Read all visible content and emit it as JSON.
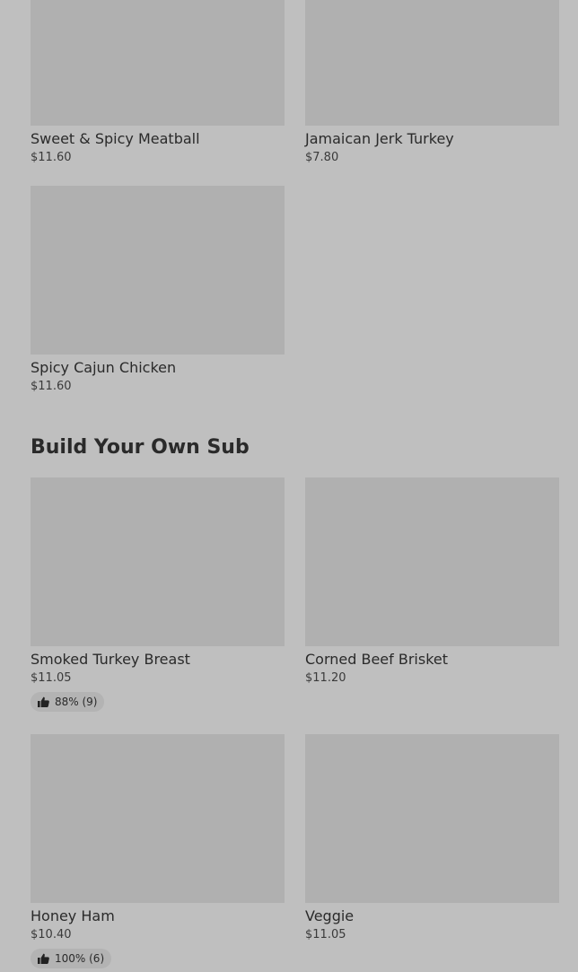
{
  "featured_items": [
    {
      "name": "Sweet & Spicy Meatball",
      "price": "$11.60"
    },
    {
      "name": "Jamaican Jerk Turkey",
      "price": "$7.80"
    },
    {
      "name": "Spicy Cajun Chicken",
      "price": "$11.60"
    }
  ],
  "build_section": {
    "title": "Build Your Own Sub",
    "items": [
      {
        "name": "Smoked Turkey Breast",
        "price": "$11.05",
        "rating": "88% (9)"
      },
      {
        "name": "Corned Beef Brisket",
        "price": "$11.20"
      },
      {
        "name": "Honey Ham",
        "price": "$10.40",
        "rating": "100% (6)"
      },
      {
        "name": "Veggie",
        "price": "$11.05"
      }
    ]
  },
  "icons": {
    "rating": "thumbs-up-icon"
  },
  "colors": {
    "background": "#bfbfbf",
    "image_placeholder": "#b0b0b0",
    "rating_pill": "#b3b3b3"
  }
}
